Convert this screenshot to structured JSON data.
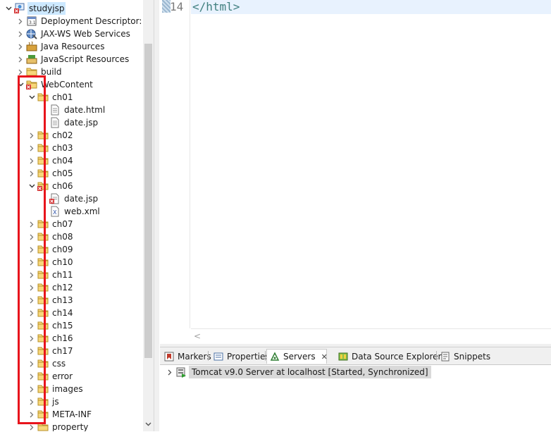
{
  "explorer": {
    "items": [
      {
        "label": "studyjsp",
        "twisty": "open",
        "icon": "project-icon",
        "selected": true
      },
      {
        "label": "Deployment Descriptor: stu",
        "twisty": "closed",
        "icon": "deployment-descriptor-icon"
      },
      {
        "label": "JAX-WS Web Services",
        "twisty": "closed",
        "icon": "web-services-icon"
      },
      {
        "label": "Java Resources",
        "twisty": "closed",
        "icon": "java-resources-icon"
      },
      {
        "label": "JavaScript Resources",
        "twisty": "closed",
        "icon": "javascript-resources-icon"
      },
      {
        "label": "build",
        "twisty": "closed",
        "icon": "folder-icon"
      },
      {
        "label": "WebContent",
        "twisty": "open",
        "icon": "folder-error-icon"
      },
      {
        "label": "ch01",
        "twisty": "open",
        "icon": "folder-icon"
      },
      {
        "label": "date.html",
        "twisty": "none",
        "icon": "file-icon"
      },
      {
        "label": "date.jsp",
        "twisty": "none",
        "icon": "file-icon"
      },
      {
        "label": "ch02",
        "twisty": "closed",
        "icon": "folder-icon"
      },
      {
        "label": "ch03",
        "twisty": "closed",
        "icon": "folder-icon"
      },
      {
        "label": "ch04",
        "twisty": "closed",
        "icon": "folder-icon"
      },
      {
        "label": "ch05",
        "twisty": "closed",
        "icon": "folder-icon"
      },
      {
        "label": "ch06",
        "twisty": "open",
        "icon": "folder-error-icon"
      },
      {
        "label": "date.jsp",
        "twisty": "none",
        "icon": "file-error-icon"
      },
      {
        "label": "web.xml",
        "twisty": "none",
        "icon": "xml-file-icon"
      },
      {
        "label": "ch07",
        "twisty": "closed",
        "icon": "folder-icon"
      },
      {
        "label": "ch08",
        "twisty": "closed",
        "icon": "folder-icon"
      },
      {
        "label": "ch09",
        "twisty": "closed",
        "icon": "folder-icon"
      },
      {
        "label": "ch10",
        "twisty": "closed",
        "icon": "folder-icon"
      },
      {
        "label": "ch11",
        "twisty": "closed",
        "icon": "folder-icon"
      },
      {
        "label": "ch12",
        "twisty": "closed",
        "icon": "folder-icon"
      },
      {
        "label": "ch13",
        "twisty": "closed",
        "icon": "folder-icon"
      },
      {
        "label": "ch14",
        "twisty": "closed",
        "icon": "folder-icon"
      },
      {
        "label": "ch15",
        "twisty": "closed",
        "icon": "folder-icon"
      },
      {
        "label": "ch16",
        "twisty": "closed",
        "icon": "folder-icon"
      },
      {
        "label": "ch17",
        "twisty": "closed",
        "icon": "folder-icon"
      },
      {
        "label": "css",
        "twisty": "closed",
        "icon": "folder-icon"
      },
      {
        "label": "error",
        "twisty": "closed",
        "icon": "folder-icon"
      },
      {
        "label": "images",
        "twisty": "closed",
        "icon": "folder-icon"
      },
      {
        "label": "js",
        "twisty": "closed",
        "icon": "folder-icon"
      },
      {
        "label": "META-INF",
        "twisty": "closed",
        "icon": "folder-icon"
      },
      {
        "label": "property",
        "twisty": "closed",
        "icon": "folder-icon"
      }
    ]
  },
  "editor": {
    "line_number": "14",
    "code": "</html>",
    "hscroll_left": "<"
  },
  "bottom_panel": {
    "tabs": [
      {
        "label": "Markers",
        "icon": "markers-icon",
        "active": false
      },
      {
        "label": "Properties",
        "icon": "properties-icon",
        "active": false
      },
      {
        "label": "Servers",
        "icon": "servers-icon",
        "active": true,
        "close": "✕"
      },
      {
        "label": "Data Source Explorer",
        "icon": "data-source-icon",
        "active": false
      },
      {
        "label": "Snippets",
        "icon": "snippets-icon",
        "active": false
      }
    ],
    "server": {
      "label": "Tomcat v9.0 Server at localhost  [Started, Synchronized]",
      "icon": "server-icon"
    }
  },
  "colors": {
    "highlight": "#e8141c",
    "selection": "#cce8ff",
    "code": "#3f7f7f"
  }
}
